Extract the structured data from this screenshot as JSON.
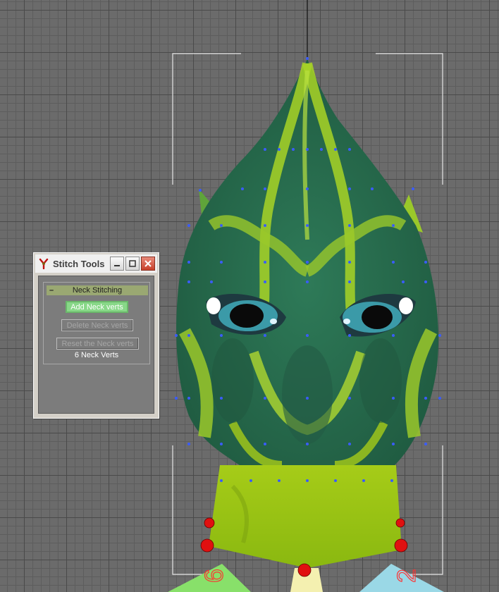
{
  "viewport": {
    "grid_color": "#6b6b6b",
    "skin_colors": {
      "dark_green": "#27634c",
      "lime": "#9ac82a",
      "eye_teal": "#3b9aa8"
    },
    "vertex_color": "#3a5cff",
    "bone_marker_color": "#e01010",
    "bone_labels": [
      "6",
      "2"
    ]
  },
  "panel": {
    "title": "Stitch Tools",
    "icon": "app-icon",
    "window_buttons": {
      "minimize": "minimize-icon",
      "maximize": "maximize-icon",
      "close": "close-icon"
    },
    "rollout": {
      "toggle": "–",
      "title": "Neck Stitching",
      "buttons": {
        "add": "Add Neck verts",
        "delete": "Delete Neck verts",
        "reset": "Reset the Neck verts"
      },
      "status": "6 Neck Verts"
    }
  }
}
